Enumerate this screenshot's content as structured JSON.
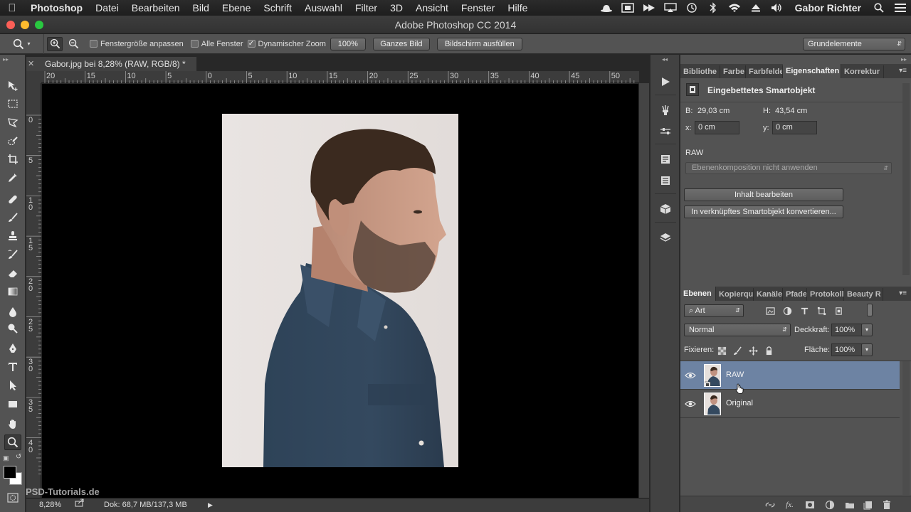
{
  "menubar": {
    "app": "Photoshop",
    "items": [
      "Datei",
      "Bearbeiten",
      "Bild",
      "Ebene",
      "Schrift",
      "Auswahl",
      "Filter",
      "3D",
      "Ansicht",
      "Fenster",
      "Hilfe"
    ],
    "user": "Gabor Richter"
  },
  "window": {
    "title": "Adobe Photoshop CC 2014"
  },
  "options": {
    "fit_window": "Fenstergröße anpassen",
    "all_windows": "Alle Fenster",
    "scrubby_zoom": "Dynamischer Zoom",
    "btn_100": "100%",
    "btn_fit": "Ganzes Bild",
    "btn_fill": "Bildschirm ausfüllen",
    "workspace": "Grundelemente"
  },
  "document": {
    "tab_title": "Gabor.jpg bei 8,28% (RAW, RGB/8) *",
    "ruler_h": [
      "20",
      "15",
      "10",
      "5",
      "0",
      "5",
      "10",
      "15",
      "20",
      "25",
      "30",
      "35",
      "40",
      "45",
      "50"
    ],
    "ruler_v": [
      "0",
      "5",
      "1\n0",
      "1\n5",
      "2\n0",
      "2\n5",
      "3\n0",
      "3\n5",
      "4\n0"
    ],
    "zoom": "8,28%",
    "doc_info": "Dok: 68,7 MB/137,3 MB",
    "watermark": "PSD-Tutorials.de"
  },
  "properties_panel": {
    "tabs": [
      "Bibliothe",
      "Farbe",
      "Farbfelde",
      "Eigenschaften",
      "Korrektur"
    ],
    "active_tab": "Eigenschaften",
    "header": "Eingebettetes Smartobjekt",
    "width_label": "B:",
    "width_value": "29,03 cm",
    "height_label": "H:",
    "height_value": "43,54 cm",
    "x_label": "x:",
    "x_value": "0 cm",
    "y_label": "y:",
    "y_value": "0 cm",
    "layer_name": "RAW",
    "comp_select": "Ebenenkomposition nicht anwenden",
    "btn_edit": "Inhalt bearbeiten",
    "btn_convert": "In verknüpftes Smartobjekt konvertieren..."
  },
  "layers_panel": {
    "tabs": [
      "Ebenen",
      "Kopierqu",
      "Kanäle",
      "Pfade",
      "Protokoll",
      "Beauty R"
    ],
    "active_tab": "Ebenen",
    "filter": "Art",
    "blend_mode": "Normal",
    "opacity_label": "Deckkraft:",
    "opacity_value": "100%",
    "lock_label": "Fixieren:",
    "fill_label": "Fläche:",
    "fill_value": "100%",
    "layers": [
      {
        "name": "RAW",
        "selected": true
      },
      {
        "name": "Original",
        "selected": false
      }
    ]
  },
  "colors": {
    "selected_layer": "#6d83a3",
    "panel_bg": "#535353",
    "canvas_bg": "#000000"
  }
}
